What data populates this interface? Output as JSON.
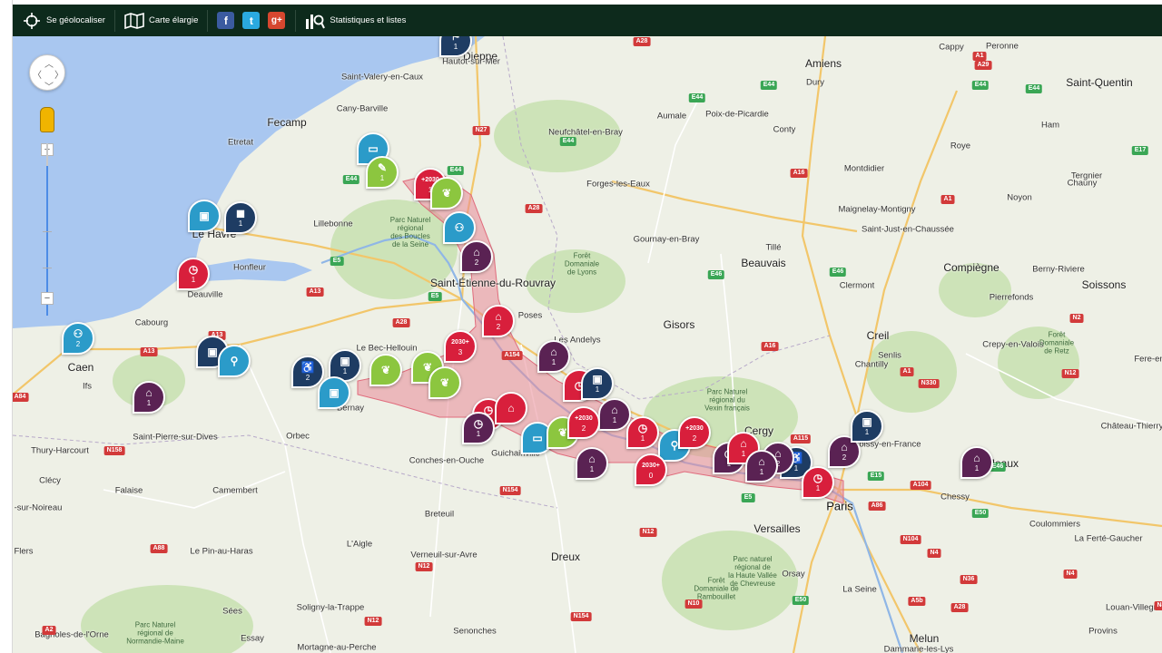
{
  "toolbar": {
    "geolocate_label": "Se géolocaliser",
    "map_label": "Carte élargie",
    "stats_label": "Statistiques et listes",
    "facebook_glyph": "f",
    "twitter_glyph": "t",
    "googleplus_glyph": "g+",
    "bg_color": "#0d2a1c"
  },
  "map_controls": {
    "zoom_in_label": "+",
    "zoom_out_label": "−",
    "zoom_level_fraction": 0.87
  },
  "colors": {
    "sea": "#a9c7f0",
    "land": "#eef0e6",
    "forest": "#cde3b8",
    "corridor": "#e98a97",
    "red": "#d81f3c",
    "crimson": "#c4122f",
    "navy": "#1e3c63",
    "purple": "#5a2253",
    "teal": "#2b9bc9",
    "green": "#8cc63f"
  },
  "places": [
    {
      "id": "p1",
      "name": "Dieppe",
      "cls": "city"
    },
    {
      "id": "p2",
      "name": "Hautot-sur-Mer",
      "cls": ""
    },
    {
      "id": "p3",
      "name": "Saint-Valery-en-Caux",
      "cls": ""
    },
    {
      "id": "p4",
      "name": "Cany-Barville",
      "cls": ""
    },
    {
      "id": "p5",
      "name": "Fecamp",
      "cls": "city"
    },
    {
      "id": "p6",
      "name": "Etretat",
      "cls": ""
    },
    {
      "id": "p7",
      "name": "Le Havre",
      "cls": "city"
    },
    {
      "id": "p8",
      "name": "Lillebonne",
      "cls": ""
    },
    {
      "id": "p9",
      "name": "Honfleur",
      "cls": ""
    },
    {
      "id": "p10",
      "name": "Deauville",
      "cls": ""
    },
    {
      "id": "p11",
      "name": "Cabourg",
      "cls": ""
    },
    {
      "id": "p12",
      "name": "Caen",
      "cls": "city"
    },
    {
      "id": "p13",
      "name": "Ifs",
      "cls": ""
    },
    {
      "id": "p14",
      "name": "Amiens",
      "cls": "city"
    },
    {
      "id": "p15",
      "name": "Dury",
      "cls": ""
    },
    {
      "id": "p16",
      "name": "Peronne",
      "cls": ""
    },
    {
      "id": "p17",
      "name": "Cappy",
      "cls": ""
    },
    {
      "id": "p18",
      "name": "Saint-Quentin",
      "cls": "city"
    },
    {
      "id": "p19",
      "name": "Ham",
      "cls": ""
    },
    {
      "id": "p20",
      "name": "Aumale",
      "cls": ""
    },
    {
      "id": "p21",
      "name": "Poix-de-Picardie",
      "cls": ""
    },
    {
      "id": "p22",
      "name": "Conty",
      "cls": ""
    },
    {
      "id": "p23",
      "name": "Neufchâtel-en-Bray",
      "cls": ""
    },
    {
      "id": "p24",
      "name": "Forges-les-Eaux",
      "cls": ""
    },
    {
      "id": "p25",
      "name": "Montdidier",
      "cls": ""
    },
    {
      "id": "p26",
      "name": "Roye",
      "cls": ""
    },
    {
      "id": "p27",
      "name": "Tergnier",
      "cls": ""
    },
    {
      "id": "p28",
      "name": "Chauny",
      "cls": ""
    },
    {
      "id": "p29",
      "name": "Noyon",
      "cls": ""
    },
    {
      "id": "p30",
      "name": "Maignelay-Montigny",
      "cls": ""
    },
    {
      "id": "p31",
      "name": "Saint-Just-en-Chaussée",
      "cls": ""
    },
    {
      "id": "p32",
      "name": "Gournay-en-Bray",
      "cls": ""
    },
    {
      "id": "p33",
      "name": "Tillé",
      "cls": ""
    },
    {
      "id": "p34",
      "name": "Beauvais",
      "cls": "city"
    },
    {
      "id": "p35",
      "name": "Compiègne",
      "cls": "city"
    },
    {
      "id": "p36",
      "name": "Berny-Riviere",
      "cls": ""
    },
    {
      "id": "p37",
      "name": "Soissons",
      "cls": "city"
    },
    {
      "id": "p38",
      "name": "Pierrefonds",
      "cls": ""
    },
    {
      "id": "p39",
      "name": "Clermont",
      "cls": ""
    },
    {
      "id": "p40",
      "name": "Saint-Étienne-du-Rouvray",
      "cls": "city"
    },
    {
      "id": "p41",
      "name": "Poses",
      "cls": ""
    },
    {
      "id": "p42",
      "name": "Les Andelys",
      "cls": ""
    },
    {
      "id": "p43",
      "name": "Gisors",
      "cls": "city"
    },
    {
      "id": "p44",
      "name": "Creil",
      "cls": "city"
    },
    {
      "id": "p45",
      "name": "Senlis",
      "cls": ""
    },
    {
      "id": "p46",
      "name": "Chantilly",
      "cls": ""
    },
    {
      "id": "p47",
      "name": "Crepy-en-Valois",
      "cls": ""
    },
    {
      "id": "p48",
      "name": "Fere-en",
      "cls": ""
    },
    {
      "id": "p49",
      "name": "Le Bec-Hellouin",
      "cls": ""
    },
    {
      "id": "p50",
      "name": "Bernay",
      "cls": ""
    },
    {
      "id": "p51",
      "name": "Orbec",
      "cls": ""
    },
    {
      "id": "p52",
      "name": "Saint-Pierre-sur-Dives",
      "cls": ""
    },
    {
      "id": "p53",
      "name": "Thury-Harcourt",
      "cls": ""
    },
    {
      "id": "p54",
      "name": "Conches-en-Ouche",
      "cls": ""
    },
    {
      "id": "p55",
      "name": "Guichainville",
      "cls": ""
    },
    {
      "id": "p56",
      "name": "Cergy",
      "cls": "city"
    },
    {
      "id": "p57",
      "name": "Roissy-en-France",
      "cls": ""
    },
    {
      "id": "p58",
      "name": "Château-Thierry",
      "cls": ""
    },
    {
      "id": "p59",
      "name": "Meaux",
      "cls": "city"
    },
    {
      "id": "p60",
      "name": "Paris",
      "cls": "big"
    },
    {
      "id": "p61",
      "name": "Chessy",
      "cls": ""
    },
    {
      "id": "p62",
      "name": "Coulommiers",
      "cls": ""
    },
    {
      "id": "p63",
      "name": "La Ferté-Gaucher",
      "cls": ""
    },
    {
      "id": "p64",
      "name": "Versailles",
      "cls": "city"
    },
    {
      "id": "p65",
      "name": "Orsay",
      "cls": ""
    },
    {
      "id": "p66",
      "name": "Falaise",
      "cls": ""
    },
    {
      "id": "p67",
      "name": "Camembert",
      "cls": ""
    },
    {
      "id": "p68",
      "name": "Clécy",
      "cls": ""
    },
    {
      "id": "p69",
      "name": "Breteuil",
      "cls": ""
    },
    {
      "id": "p70",
      "name": "L'Aigle",
      "cls": ""
    },
    {
      "id": "p71",
      "name": "Verneuil-sur-Avre",
      "cls": ""
    },
    {
      "id": "p72",
      "name": "Dreux",
      "cls": "city"
    },
    {
      "id": "p73",
      "name": "Flers",
      "cls": ""
    },
    {
      "id": "p74",
      "name": "Le Pin-au-Haras",
      "cls": ""
    },
    {
      "id": "p75",
      "name": "Sées",
      "cls": ""
    },
    {
      "id": "p76",
      "name": "Essay",
      "cls": ""
    },
    {
      "id": "p77",
      "name": "Soligny-la-Trappe",
      "cls": ""
    },
    {
      "id": "p78",
      "name": "Senonches",
      "cls": ""
    },
    {
      "id": "p79",
      "name": "Bagnoles-de-l'Orne",
      "cls": ""
    },
    {
      "id": "p80",
      "name": "Mortagne-au-Perche",
      "cls": ""
    },
    {
      "id": "p81",
      "name": "Melun",
      "cls": "city"
    },
    {
      "id": "p82",
      "name": "Dammarie-les-Lys",
      "cls": ""
    },
    {
      "id": "p83",
      "name": "Provins",
      "cls": ""
    },
    {
      "id": "p84",
      "name": "Louan-Villegruis",
      "cls": ""
    },
    {
      "id": "p85",
      "name": "-sur-Noireau",
      "cls": ""
    },
    {
      "id": "p86",
      "name": "La Seine",
      "cls": ""
    }
  ],
  "parks": [
    {
      "id": "k1",
      "text": "Parc Naturel\nrégional\ndes Boucles\nde la Seine"
    },
    {
      "id": "k2",
      "text": "Forêt\nDomaniale\nde Lyons"
    },
    {
      "id": "k3",
      "text": "Parc Naturel\nrégional du\nVexin français"
    },
    {
      "id": "k4",
      "text": "Forêt\nDomaniale\nde Retz"
    },
    {
      "id": "k5",
      "text": "Parc naturel\nrégional de\nla Haute Vallée\nde Chevreuse"
    },
    {
      "id": "k6",
      "text": "Forêt\nDomaniale de\nRambouillet"
    },
    {
      "id": "k7",
      "text": "Parc Naturel\nrégional de\nNormandie-Maine"
    }
  ],
  "roads": [
    {
      "id": "r1",
      "label": "A28",
      "type": "a"
    },
    {
      "id": "r2",
      "label": "N27",
      "type": "a"
    },
    {
      "id": "r3",
      "label": "E44",
      "type": "e"
    },
    {
      "id": "r4",
      "label": "E44",
      "type": "e"
    },
    {
      "id": "r5",
      "label": "E44",
      "type": "e"
    },
    {
      "id": "r6",
      "label": "E44",
      "type": "e"
    },
    {
      "id": "r7",
      "label": "E44",
      "type": "e"
    },
    {
      "id": "r8",
      "label": "A29",
      "type": "a"
    },
    {
      "id": "r9",
      "label": "A1",
      "type": "a"
    },
    {
      "id": "r10",
      "label": "E44",
      "type": "e"
    },
    {
      "id": "r11",
      "label": "E44",
      "type": "e"
    },
    {
      "id": "r12",
      "label": "A16",
      "type": "a"
    },
    {
      "id": "r13",
      "label": "E17",
      "type": "e"
    },
    {
      "id": "r14",
      "label": "A1",
      "type": "a"
    },
    {
      "id": "r15",
      "label": "A28",
      "type": "a"
    },
    {
      "id": "r16",
      "label": "E46",
      "type": "e"
    },
    {
      "id": "r17",
      "label": "E46",
      "type": "e"
    },
    {
      "id": "r18",
      "label": "N2",
      "type": "a"
    },
    {
      "id": "r19",
      "label": "A13",
      "type": "a"
    },
    {
      "id": "r20",
      "label": "E5",
      "type": "e"
    },
    {
      "id": "r21",
      "label": "A28",
      "type": "a"
    },
    {
      "id": "r22",
      "label": "E5",
      "type": "e"
    },
    {
      "id": "r23",
      "label": "A154",
      "type": "a"
    },
    {
      "id": "r24",
      "label": "A16",
      "type": "a"
    },
    {
      "id": "r25",
      "label": "A1",
      "type": "a"
    },
    {
      "id": "r26",
      "label": "N330",
      "type": "a"
    },
    {
      "id": "r27",
      "label": "N12",
      "type": "a"
    },
    {
      "id": "r28",
      "label": "A84",
      "type": "a"
    },
    {
      "id": "r29",
      "label": "A13",
      "type": "a"
    },
    {
      "id": "r30",
      "label": "A13",
      "type": "a"
    },
    {
      "id": "r31",
      "label": "N158",
      "type": "a"
    },
    {
      "id": "r32",
      "label": "N154",
      "type": "a"
    },
    {
      "id": "r33",
      "label": "A115",
      "type": "a"
    },
    {
      "id": "r34",
      "label": "E15",
      "type": "e"
    },
    {
      "id": "r35",
      "label": "A104",
      "type": "a"
    },
    {
      "id": "r36",
      "label": "E50",
      "type": "e"
    },
    {
      "id": "r37",
      "label": "E5",
      "type": "e"
    },
    {
      "id": "r38",
      "label": "A86",
      "type": "a"
    },
    {
      "id": "r39",
      "label": "N12",
      "type": "a"
    },
    {
      "id": "r40",
      "label": "A88",
      "type": "a"
    },
    {
      "id": "r41",
      "label": "N12",
      "type": "a"
    },
    {
      "id": "r42",
      "label": "N10",
      "type": "a"
    },
    {
      "id": "r43",
      "label": "E50",
      "type": "e"
    },
    {
      "id": "r44",
      "label": "N104",
      "type": "a"
    },
    {
      "id": "r45",
      "label": "N4",
      "type": "a"
    },
    {
      "id": "r46",
      "label": "N36",
      "type": "a"
    },
    {
      "id": "r47",
      "label": "N4",
      "type": "a"
    },
    {
      "id": "r48",
      "label": "A5b",
      "type": "a"
    },
    {
      "id": "r49",
      "label": "A28",
      "type": "a"
    },
    {
      "id": "r50",
      "label": "N12",
      "type": "a"
    },
    {
      "id": "r51",
      "label": "N154",
      "type": "a"
    },
    {
      "id": "r52",
      "label": "N4",
      "type": "a"
    },
    {
      "id": "r53",
      "label": "A2",
      "type": "a"
    },
    {
      "id": "r54",
      "label": "E46",
      "type": "e"
    }
  ],
  "pins": [
    {
      "id": "m1",
      "color": "navy",
      "glyph": "⚑",
      "count": "1",
      "type": "train"
    },
    {
      "id": "m2",
      "color": "teal",
      "glyph": "▭",
      "count": "",
      "type": "bus"
    },
    {
      "id": "m3",
      "color": "green",
      "glyph": "✎",
      "count": "1",
      "type": "landscape"
    },
    {
      "id": "m4",
      "color": "red",
      "glyph": "+2030",
      "count": "1",
      "type": "project-2030"
    },
    {
      "id": "m5",
      "color": "green",
      "glyph": "❦",
      "count": "",
      "type": "nature"
    },
    {
      "id": "m6",
      "color": "teal",
      "glyph": "⚇",
      "count": "",
      "type": "pedestrian"
    },
    {
      "id": "m7",
      "color": "purple",
      "glyph": "⌂",
      "count": "2",
      "type": "heritage"
    },
    {
      "id": "m8",
      "color": "teal",
      "glyph": "▣",
      "count": "",
      "type": "bus"
    },
    {
      "id": "m9",
      "color": "navy",
      "glyph": "◼",
      "count": "1",
      "type": "rail"
    },
    {
      "id": "m10",
      "color": "red",
      "glyph": "◷",
      "count": "1",
      "type": "clock"
    },
    {
      "id": "m11",
      "color": "teal",
      "glyph": "⚇",
      "count": "2",
      "type": "pedestrian"
    },
    {
      "id": "m12",
      "color": "purple",
      "glyph": "⌂",
      "count": "1",
      "type": "heritage"
    },
    {
      "id": "m13",
      "color": "navy",
      "glyph": "▣",
      "count": "",
      "type": "bus"
    },
    {
      "id": "m14",
      "color": "teal",
      "glyph": "⚲",
      "count": "",
      "type": "bike"
    },
    {
      "id": "m15",
      "color": "navy",
      "glyph": "♿",
      "count": "2",
      "type": "accessibility"
    },
    {
      "id": "m16",
      "color": "navy",
      "glyph": "▣",
      "count": "1",
      "type": "bus"
    },
    {
      "id": "m17",
      "color": "teal",
      "glyph": "▣",
      "count": "",
      "type": "bus"
    },
    {
      "id": "m18",
      "color": "green",
      "glyph": "❦",
      "count": "",
      "type": "nature"
    },
    {
      "id": "m19",
      "color": "green",
      "glyph": "❦",
      "count": "",
      "type": "nature"
    },
    {
      "id": "m20",
      "color": "green",
      "glyph": "❦",
      "count": "",
      "type": "nature"
    },
    {
      "id": "m21",
      "color": "red",
      "glyph": "2030+",
      "count": "3",
      "type": "project-2030"
    },
    {
      "id": "m22",
      "color": "red",
      "glyph": "⌂",
      "count": "2",
      "type": "heritage"
    },
    {
      "id": "m23",
      "color": "purple",
      "glyph": "⌂",
      "count": "1",
      "type": "heritage"
    },
    {
      "id": "m24",
      "color": "red",
      "glyph": "◷",
      "count": "",
      "type": "clock"
    },
    {
      "id": "m25",
      "color": "navy",
      "glyph": "▣",
      "count": "1",
      "type": "bus"
    },
    {
      "id": "m26",
      "color": "purple",
      "glyph": "⌂",
      "count": "1",
      "type": "heritage"
    },
    {
      "id": "m27",
      "color": "red",
      "glyph": "◷",
      "count": "1",
      "type": "clock"
    },
    {
      "id": "m28",
      "color": "red",
      "glyph": "⌂",
      "count": "",
      "type": "heritage"
    },
    {
      "id": "m29",
      "color": "purple",
      "glyph": "◷",
      "count": "1",
      "type": "clock"
    },
    {
      "id": "m30",
      "color": "teal",
      "glyph": "▭",
      "count": "",
      "type": "car"
    },
    {
      "id": "m31",
      "color": "green",
      "glyph": "❦",
      "count": "",
      "type": "nature"
    },
    {
      "id": "m32",
      "color": "red",
      "glyph": "+2030",
      "count": "2",
      "type": "project-2030"
    },
    {
      "id": "m33",
      "color": "purple",
      "glyph": "⌂",
      "count": "1",
      "type": "heritage"
    },
    {
      "id": "m34",
      "color": "red",
      "glyph": "◷",
      "count": "1",
      "type": "clock"
    },
    {
      "id": "m35",
      "color": "teal",
      "glyph": "⚲",
      "count": "",
      "type": "bike"
    },
    {
      "id": "m36",
      "color": "red",
      "glyph": "+2030",
      "count": "2",
      "type": "project-2030"
    },
    {
      "id": "m37",
      "color": "red",
      "glyph": "2030+",
      "count": "0",
      "type": "project-2030"
    },
    {
      "id": "m38",
      "color": "purple",
      "glyph": "◷",
      "count": "1",
      "type": "clock"
    },
    {
      "id": "m39",
      "color": "red",
      "glyph": "⌂",
      "count": "1",
      "type": "heritage"
    },
    {
      "id": "m40",
      "color": "purple",
      "glyph": "⌂",
      "count": "2",
      "type": "heritage"
    },
    {
      "id": "m41",
      "color": "navy",
      "glyph": "♿",
      "count": "1",
      "type": "accessibility"
    },
    {
      "id": "m42",
      "color": "red",
      "glyph": "◷",
      "count": "1",
      "type": "clock"
    },
    {
      "id": "m43",
      "color": "purple",
      "glyph": "⌂",
      "count": "2",
      "type": "heritage"
    },
    {
      "id": "m44",
      "color": "navy",
      "glyph": "▣",
      "count": "1",
      "type": "bus"
    },
    {
      "id": "m45",
      "color": "purple",
      "glyph": "⌂",
      "count": "1",
      "type": "heritage"
    },
    {
      "id": "m46",
      "color": "purple",
      "glyph": "⌂",
      "count": "1",
      "type": "heritage"
    }
  ]
}
